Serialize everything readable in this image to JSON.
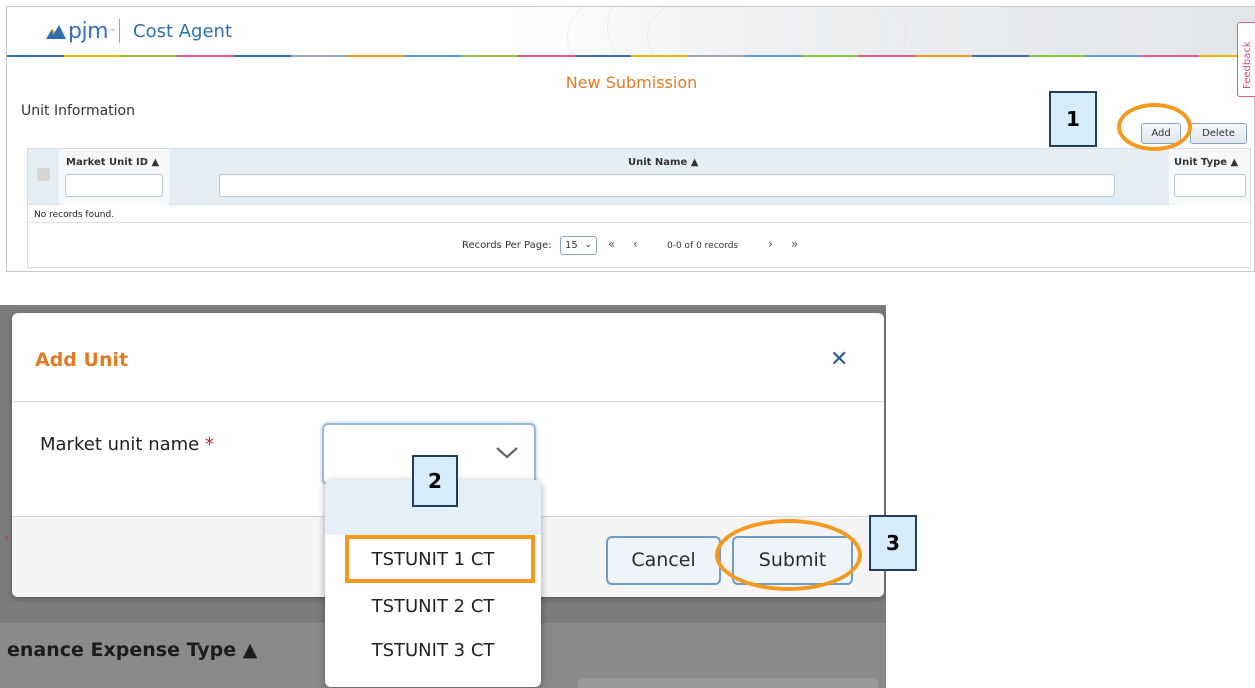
{
  "header": {
    "logo_text": "pjm",
    "app_title": "Cost Agent",
    "feedback_label": "Feedback",
    "rainbow_colors": [
      "#3b6fb6",
      "#f2b705",
      "#8cc63f",
      "#e05a8a",
      "#2f6fb0",
      "#9aa5b1",
      "#f39a1e",
      "#5aa0d8",
      "#8cc63f",
      "#e05a8a",
      "#3b6fb6",
      "#f2b705",
      "#9aa5b1",
      "#5aa0d8",
      "#8cc63f",
      "#e05a8a",
      "#f39a1e",
      "#3b6fb6",
      "#8cc63f",
      "#5aa0d8",
      "#e05a8a",
      "#f2b705"
    ]
  },
  "page": {
    "subtitle": "New Submission",
    "section_title": "Unit Information"
  },
  "toolbar": {
    "add_label": "Add",
    "delete_label": "Delete"
  },
  "grid": {
    "columns": [
      {
        "label": "Market Unit ID",
        "sort_icon": "sort-icon"
      },
      {
        "label": "Unit Name",
        "sort_icon": "sort-icon"
      },
      {
        "label": "Unit Type",
        "sort_icon": "sort-icon"
      }
    ],
    "empty_message": "No records found.",
    "pager": {
      "records_per_page_label": "Records Per Page:",
      "records_per_page_value": "15",
      "first": "«",
      "prev": "‹",
      "info": "0-0 of 0 records",
      "next": "›",
      "last": "»"
    }
  },
  "callouts": {
    "step1": "1",
    "step2": "2",
    "step3": "3"
  },
  "modal": {
    "title": "Add Unit",
    "close_glyph": "✕",
    "field_label": "Market unit name",
    "required_mark": "*",
    "select_value": "",
    "cancel_label": "Cancel",
    "submit_label": "Submit"
  },
  "dropdown": {
    "options": [
      "TSTUNIT 1 CT",
      "TSTUNIT 2 CT",
      "TSTUNIT 3 CT"
    ],
    "highlighted_index": 0
  },
  "background": {
    "column_label": "enance Expense Type"
  },
  "colors": {
    "accent_orange": "#e07b26",
    "callout_ring": "#f39a1e",
    "brand_blue": "#2f6fb0"
  }
}
